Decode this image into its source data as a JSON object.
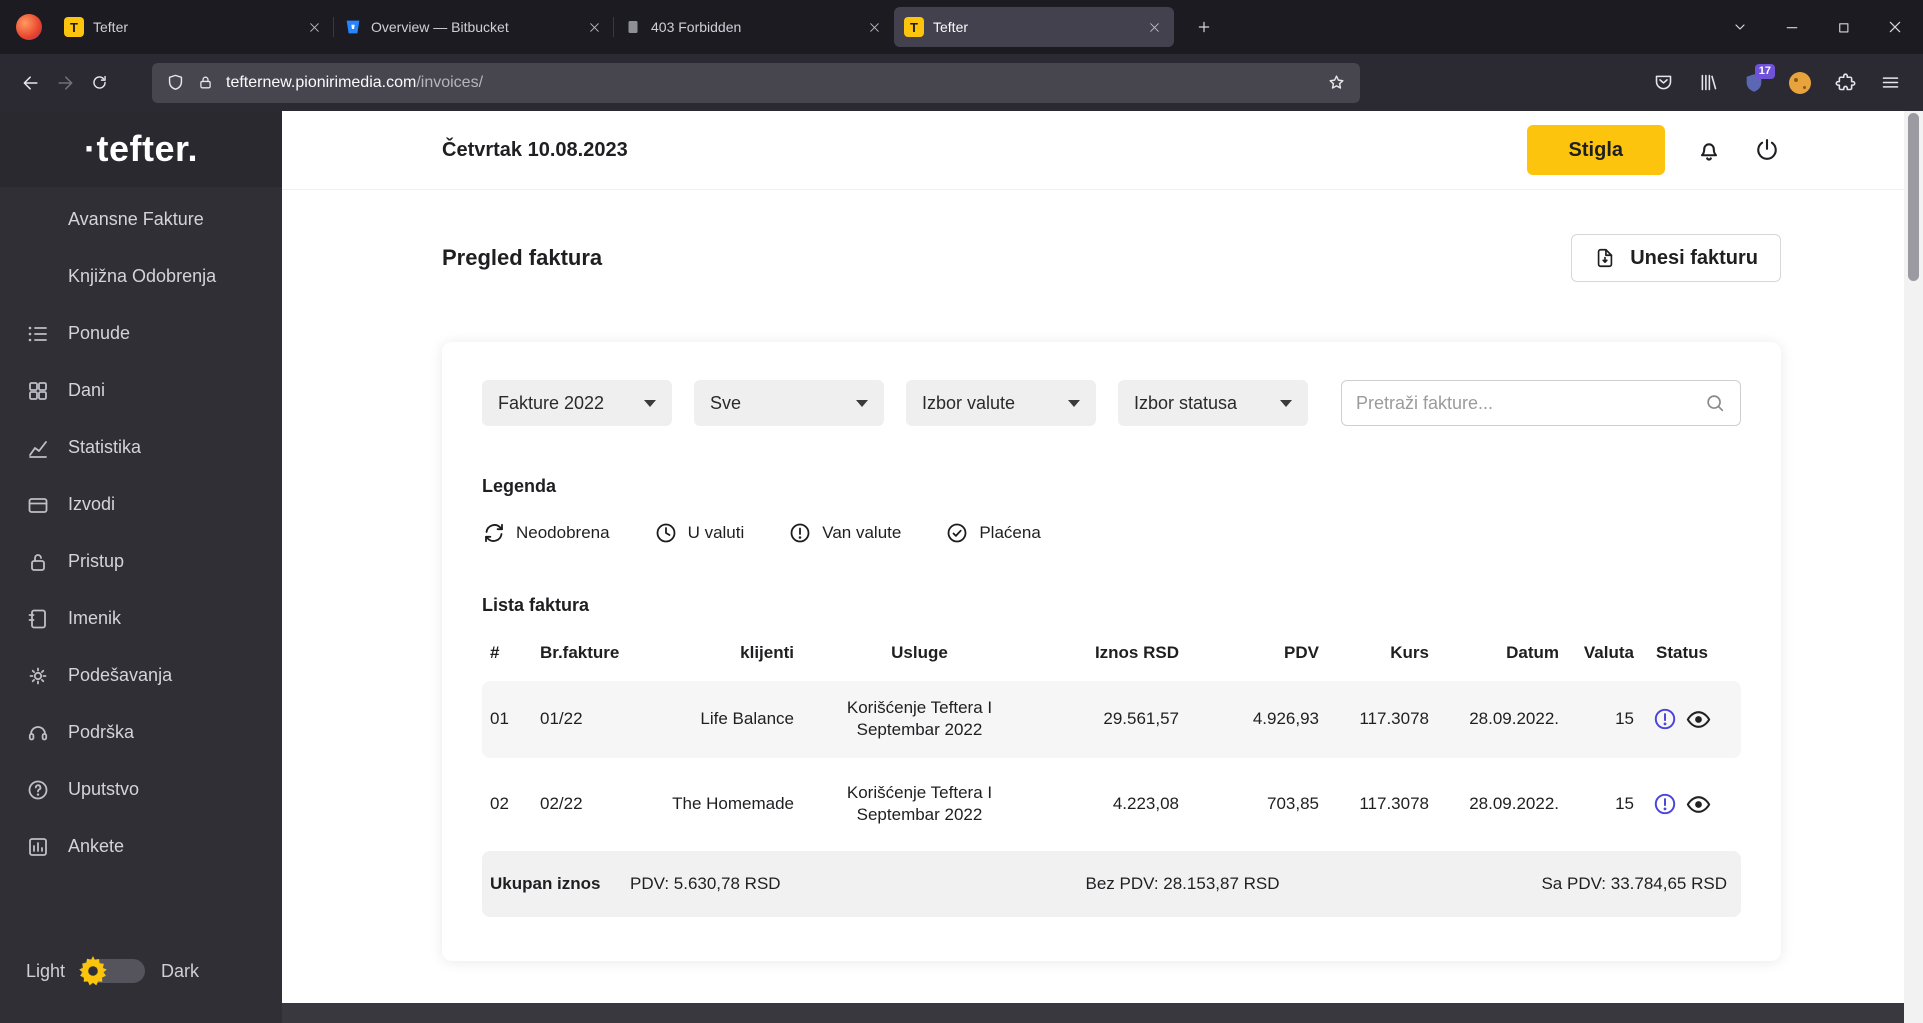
{
  "colors": {
    "accent_yellow": "#fcc40d",
    "status_purple": "#4a44d8"
  },
  "browser": {
    "tabs": [
      {
        "title": "Tefter"
      },
      {
        "title": "Overview — Bitbucket"
      },
      {
        "title": "403 Forbidden"
      },
      {
        "title": "Tefter"
      }
    ],
    "favicon_letter": "T",
    "url_host": "tefternew.pionirimedia.com",
    "url_path": "/invoices/",
    "ext_badge": "17"
  },
  "sidebar": {
    "logo": "·tefter.",
    "items": [
      {
        "label": "Avansne Fakture"
      },
      {
        "label": "Knjižna Odobrenja"
      },
      {
        "label": "Ponude"
      },
      {
        "label": "Dani"
      },
      {
        "label": "Statistika"
      },
      {
        "label": "Izvodi"
      },
      {
        "label": "Pristup"
      },
      {
        "label": "Imenik"
      },
      {
        "label": "Podešavanja"
      },
      {
        "label": "Podrška"
      },
      {
        "label": "Uputstvo"
      },
      {
        "label": "Ankete"
      }
    ],
    "theme": {
      "light": "Light",
      "dark": "Dark"
    }
  },
  "header": {
    "date": "Četvrtak 10.08.2023",
    "status_button": "Stigla"
  },
  "page": {
    "title": "Pregled faktura",
    "add_button": "Unesi fakturu"
  },
  "filters": {
    "year": "Fakture 2022",
    "type": "Sve",
    "currency": "Izbor valute",
    "status": "Izbor statusa",
    "search_placeholder": "Pretraži fakture..."
  },
  "legend": {
    "title": "Legenda",
    "items": [
      {
        "label": "Neodobrena"
      },
      {
        "label": "U valuti"
      },
      {
        "label": "Van valute"
      },
      {
        "label": "Plaćena"
      }
    ]
  },
  "invoices": {
    "title": "Lista faktura",
    "columns": [
      "#",
      "Br.fakture",
      "klijenti",
      "Usluge",
      "Iznos RSD",
      "PDV",
      "Kurs",
      "Datum",
      "Valuta",
      "Status"
    ],
    "rows": [
      {
        "num": "01",
        "br": "01/22",
        "client": "Life Balance",
        "service": "Korišćenje Teftera I Septembar 2022",
        "amount": "29.561,57",
        "pdv": "4.926,93",
        "kurs": "117.3078",
        "date": "28.09.2022.",
        "valuta": "15"
      },
      {
        "num": "02",
        "br": "02/22",
        "client": "The Homemade",
        "service": "Korišćenje Teftera I Septembar 2022",
        "amount": "4.223,08",
        "pdv": "703,85",
        "kurs": "117.3078",
        "date": "28.09.2022.",
        "valuta": "15"
      }
    ],
    "totals": {
      "label": "Ukupan iznos",
      "pdv": "PDV: 5.630,78 RSD",
      "bez_pdv": "Bez PDV: 28.153,87 RSD",
      "sa_pdv": "Sa PDV: 33.784,65 RSD"
    }
  }
}
